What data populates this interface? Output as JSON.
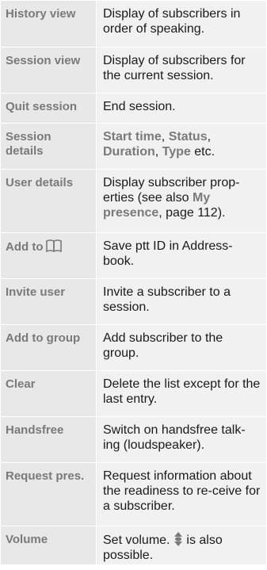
{
  "rows": [
    {
      "term": "History view",
      "desc": "Display of subscribers in order of speaking."
    },
    {
      "term": "Session view",
      "desc": "Display of subscribers for the current session."
    },
    {
      "term": "Quit session",
      "desc": "End session."
    },
    {
      "term": "Session details",
      "desc_parts": {
        "k1": "Start time",
        "s1": ", ",
        "k2": "Status",
        "s2": ", ",
        "k3": "Duration",
        "s3": ", ",
        "k4": "Type",
        "s4": " etc."
      }
    },
    {
      "term": "User details",
      "desc_parts": {
        "t1": "Display subscriber prop-erties (see also ",
        "k1": "My presence",
        "t2": ", page 112)."
      }
    },
    {
      "term": "Add to",
      "term_icon": "addressbook-icon",
      "desc": "Save ptt ID in Address-book."
    },
    {
      "term": "Invite user",
      "desc": "Invite a subscriber to a session."
    },
    {
      "term": "Add to group",
      "desc": "Add subscriber to the group."
    },
    {
      "term": "Clear",
      "desc": "Delete the list except for the last entry."
    },
    {
      "term": "Handsfree",
      "desc": "Switch on handsfree talk-ing (loudspeaker)."
    },
    {
      "term": "Request pres.",
      "desc": "Request information about the readiness to re-ceive for a subscriber."
    },
    {
      "term": "Volume",
      "desc_parts": {
        "t1": "Set volume. ",
        "icon": "volume-key-icon",
        "t2": " is also possible."
      }
    }
  ]
}
